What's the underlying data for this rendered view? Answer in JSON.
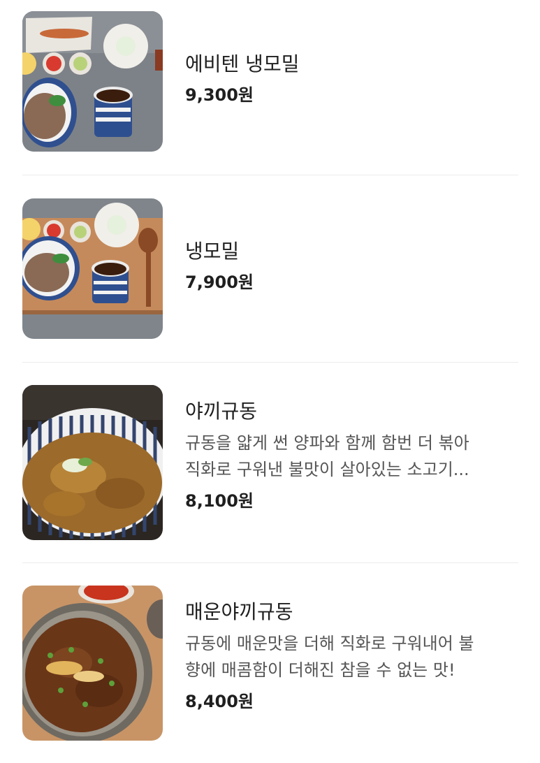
{
  "menu": {
    "items": [
      {
        "name": "에비텐 냉모밀",
        "description": "",
        "price": "9,300원",
        "image": "tempura-soba-photo"
      },
      {
        "name": "냉모밀",
        "description": "",
        "price": "7,900원",
        "image": "cold-soba-photo"
      },
      {
        "name": "야끼규동",
        "description_lines": [
          "규동을 얇게 썬 양파와 함께 함번 더 볶아",
          "직화로 구워낸 불맛이 살아있는 소고기..."
        ],
        "price": "8,100원",
        "image": "yaki-gyudon-photo"
      },
      {
        "name": "매운야끼규동",
        "description_lines": [
          "규동에 매운맛을 더해 직화로 구워내어 불",
          "향에 매콤함이 더해진 참을 수 없는 맛!"
        ],
        "price": "8,400원",
        "image": "spicy-yaki-gyudon-photo"
      }
    ]
  },
  "colors": {
    "text": "#1f1f1f",
    "description": "#555555",
    "divider": "#ececec",
    "background": "#ffffff"
  }
}
